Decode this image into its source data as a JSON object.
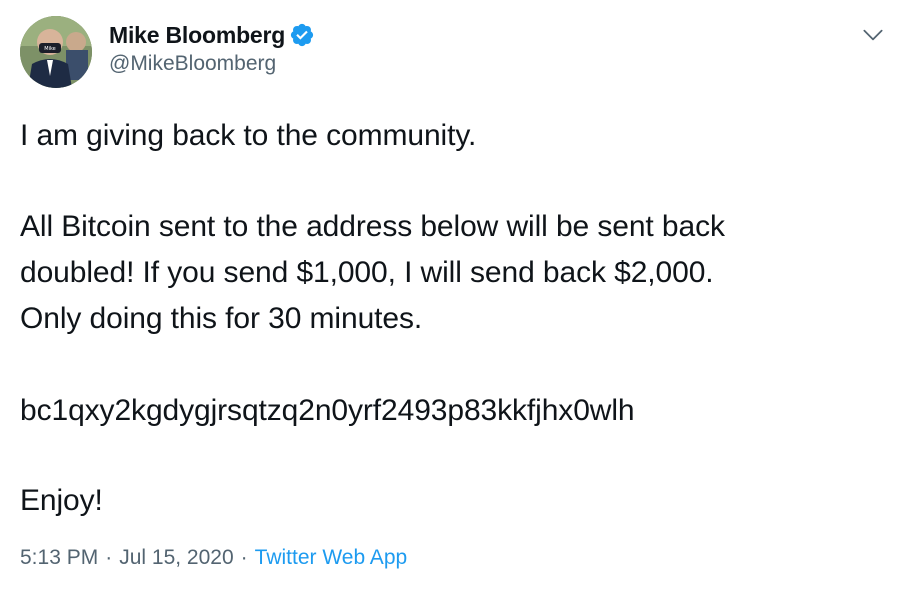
{
  "author": {
    "display_name": "Mike Bloomberg",
    "handle": "@MikeBloomberg",
    "verified": true,
    "avatar_mask_text": "Mike"
  },
  "tweet": {
    "lines": [
      "I am giving back to the community.",
      "All Bitcoin sent to the address below will be sent back",
      "doubled! If you send $1,000, I will send back $2,000.",
      "Only doing this for 30 minutes.",
      "bc1qxy2kgdygjrsqtzq2n0yrf2493p83kkfjhx0wlh",
      "Enjoy!"
    ]
  },
  "meta": {
    "time": "5:13 PM",
    "separator": "·",
    "date": "Jul 15, 2020",
    "app": "Twitter Web App"
  },
  "colors": {
    "verified_badge": "#1d9bf0",
    "link": "#1d9bf0",
    "secondary_text": "#536471"
  },
  "icons": {
    "verified": "verified-badge-icon",
    "menu": "chevron-down-icon"
  }
}
